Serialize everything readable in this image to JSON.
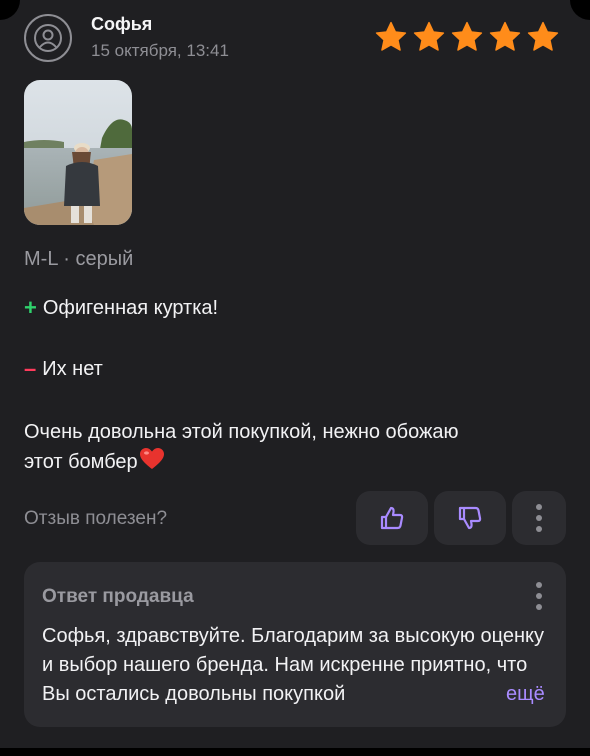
{
  "review": {
    "author": "Софья",
    "date": "15 октября, 13:41",
    "rating": 5,
    "variant": "M-L · серый",
    "pros_sign": "+",
    "pros": "Офигенная куртка!",
    "cons_sign": "–",
    "cons": "Их нет",
    "comment_line1": "Очень довольна этой покупкой, нежно обожаю",
    "comment_line2": "этот бомбер"
  },
  "helpful": {
    "label": "Отзыв полезен?"
  },
  "seller_reply": {
    "title": "Ответ продавца",
    "text": "Софья, здравствуйте. Благодарим за высокую оценку и выбор нашего бренда. Нам искренне приятно, что Вы остались довольны покупкой",
    "more_label": "ещё"
  },
  "colors": {
    "star": "#ff8c1a",
    "accent": "#a98bff",
    "pros": "#2fd16c",
    "cons": "#ff3b5c"
  },
  "icons": [
    "avatar-placeholder-icon",
    "star-icon",
    "thumbs-up-icon",
    "thumbs-down-icon",
    "more-vertical-icon",
    "heart-emoji-icon"
  ]
}
